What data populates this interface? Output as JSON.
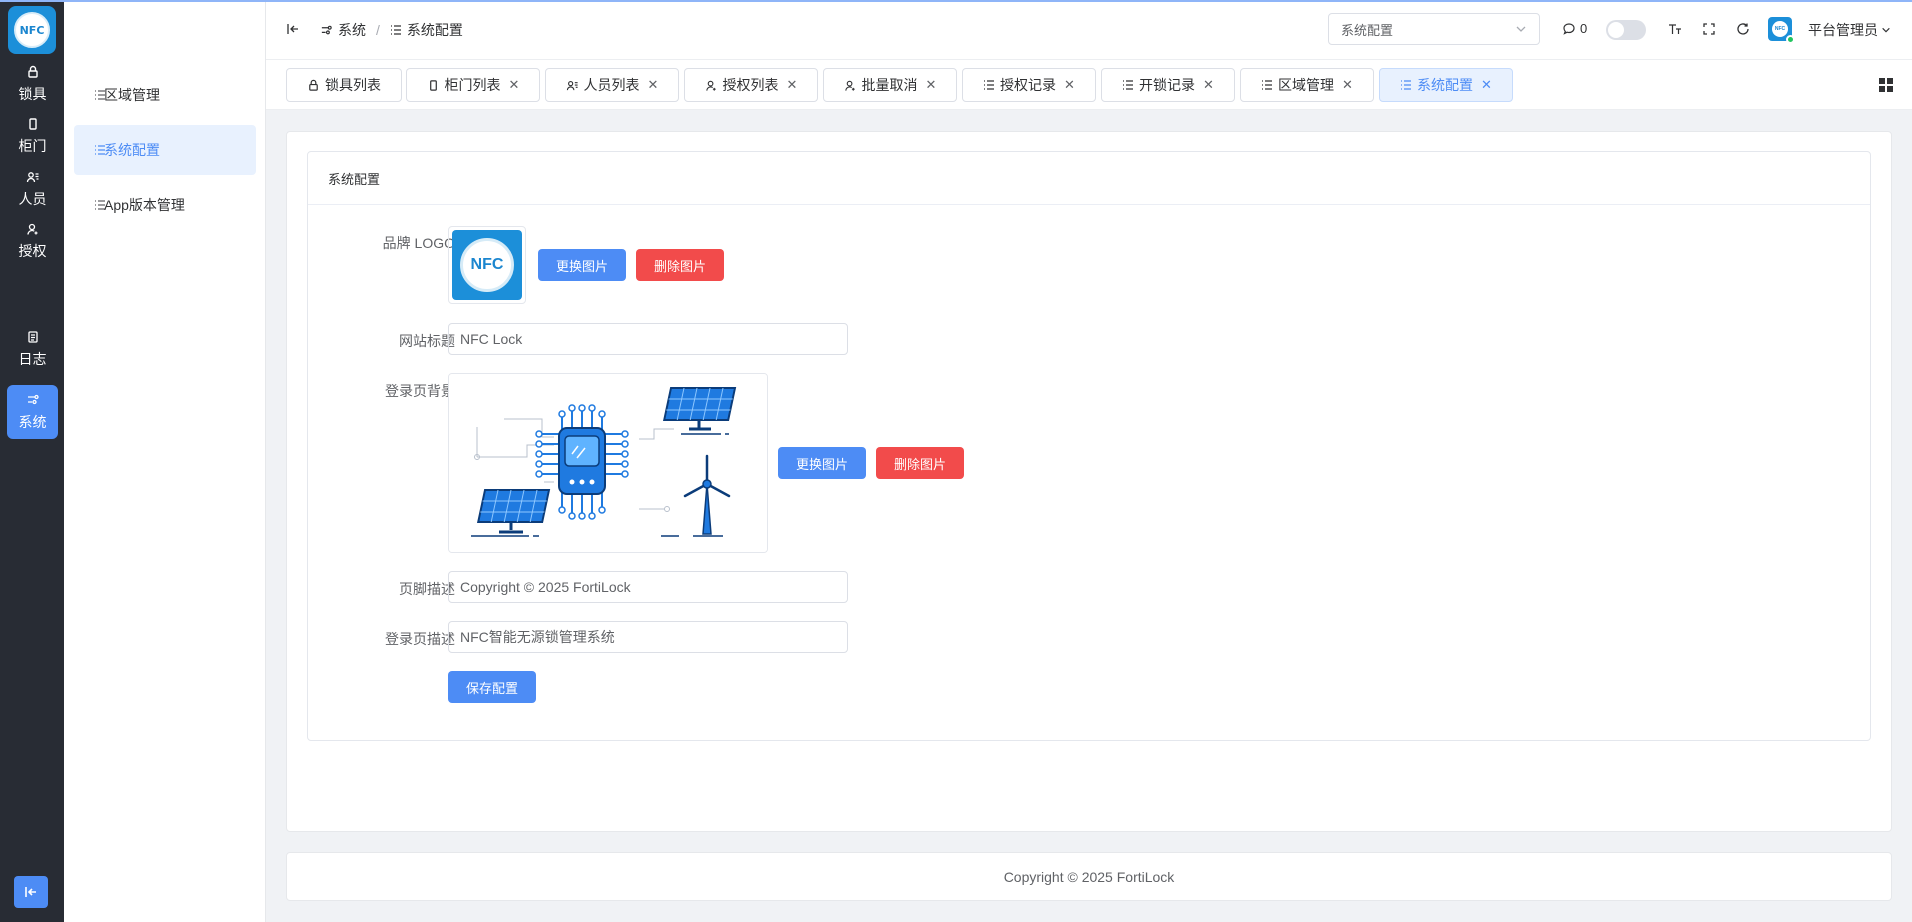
{
  "rail": {
    "logo_text": "NFC",
    "items": [
      {
        "label": "锁具",
        "icon": "lock-icon"
      },
      {
        "label": "柜门",
        "icon": "door-icon"
      },
      {
        "label": "人员",
        "icon": "users-icon"
      },
      {
        "label": "授权",
        "icon": "user-key-icon"
      },
      {
        "label": "日志",
        "icon": "log-icon"
      },
      {
        "label": "系统",
        "icon": "settings-sliders-icon"
      }
    ],
    "active_index": 5,
    "collapse_icon": "collapse-left-icon"
  },
  "sidebar": {
    "items": [
      {
        "label": "区域管理"
      },
      {
        "label": "系统配置"
      },
      {
        "label": "App版本管理"
      }
    ],
    "active_index": 1
  },
  "header": {
    "breadcrumb": [
      "系统",
      "系统配置"
    ],
    "select_value": "系统配置",
    "message_count": "0",
    "user_name": "平台管理员",
    "avatar_text": "NFC"
  },
  "tabs": [
    {
      "label": "锁具列表",
      "icon": "lock-icon",
      "closable": false
    },
    {
      "label": "柜门列表",
      "icon": "door-icon",
      "closable": true
    },
    {
      "label": "人员列表",
      "icon": "users-icon",
      "closable": true
    },
    {
      "label": "授权列表",
      "icon": "user-key-icon",
      "closable": true
    },
    {
      "label": "批量取消",
      "icon": "user-key-icon",
      "closable": true
    },
    {
      "label": "授权记录",
      "icon": "list-icon",
      "closable": true
    },
    {
      "label": "开锁记录",
      "icon": "list-icon",
      "closable": true
    },
    {
      "label": "区域管理",
      "icon": "list-icon",
      "closable": true
    },
    {
      "label": "系统配置",
      "icon": "list-icon",
      "closable": true,
      "active": true
    }
  ],
  "config": {
    "panel_title": "系统配置",
    "brand_logo_label": "品牌 LOGO",
    "logo_text": "NFC",
    "change_image": "更换图片",
    "delete_image": "删除图片",
    "site_title_label": "网站标题",
    "site_title_value": "NFC Lock",
    "login_bg_label": "登录页背景",
    "footer_desc_label": "页脚描述",
    "footer_desc_value": "Copyright © 2025 FortiLock",
    "login_desc_label": "登录页描述",
    "login_desc_value": "NFC智能无源锁管理系统",
    "save_button": "保存配置"
  },
  "footer": {
    "text": "Copyright © 2025 FortiLock"
  },
  "colors": {
    "primary": "#4d8cf5",
    "danger": "#f24b4b",
    "rail_bg": "#282c34",
    "brand": "#1c8fd9"
  }
}
